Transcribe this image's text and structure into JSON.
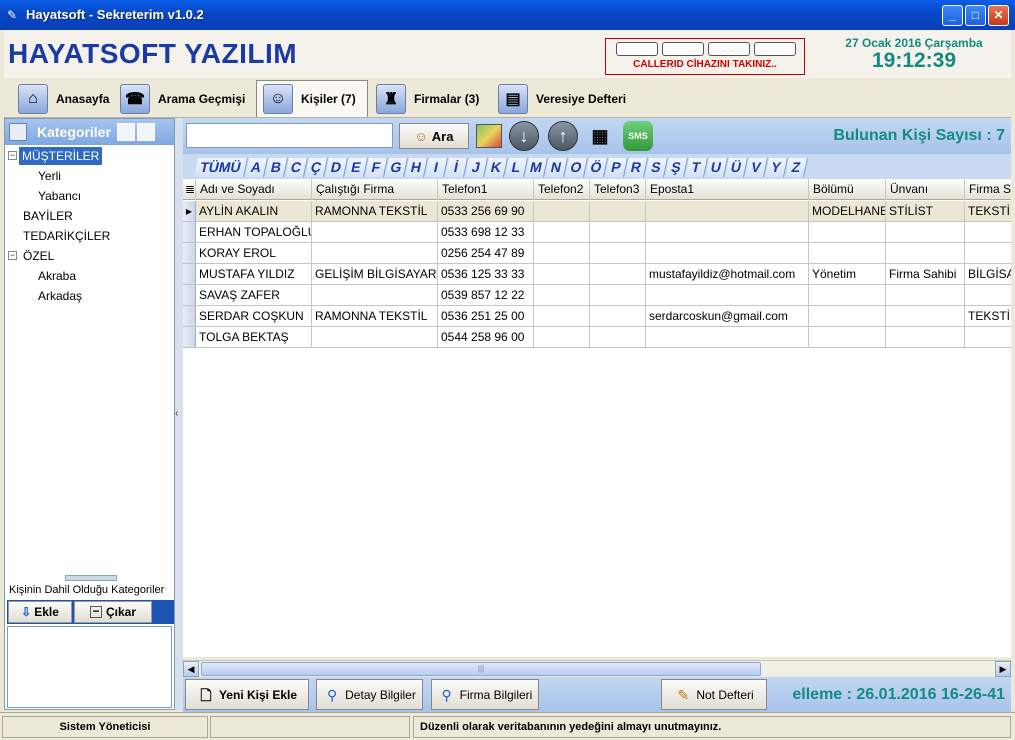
{
  "window": {
    "title": "Hayatsoft - Sekreterim v1.0.2"
  },
  "header": {
    "brand": "HAYATSOFT YAZILIM",
    "callerid_message": "CALLERID CİHAZINI TAKINIZ..",
    "date": "27 Ocak 2016 Çarşamba",
    "time": "19:12:39"
  },
  "tabs": [
    {
      "label": "Anasayfa",
      "icon": "house-icon"
    },
    {
      "label": "Arama Geçmişi",
      "icon": "phone-book-icon"
    },
    {
      "label": "Kişiler (7)",
      "icon": "contacts-icon",
      "active": true
    },
    {
      "label": "Firmalar (3)",
      "icon": "company-icon"
    },
    {
      "label": "Veresiye Defteri",
      "icon": "ledger-icon"
    }
  ],
  "sidebar": {
    "title": "Kategoriler",
    "tree": [
      {
        "label": "MÜŞTERİLER",
        "level": 0,
        "selected": true,
        "expanded": true
      },
      {
        "label": "Yerli",
        "level": 1
      },
      {
        "label": "Yabancı",
        "level": 1
      },
      {
        "label": "BAYİLER",
        "level": 0
      },
      {
        "label": "TEDARİKÇİLER",
        "level": 0
      },
      {
        "label": "ÖZEL",
        "level": 0,
        "expanded": true
      },
      {
        "label": "Akraba",
        "level": 1
      },
      {
        "label": "Arkadaş",
        "level": 1
      }
    ],
    "category_label": "Kişinin Dahil Olduğu Kategoriler",
    "add_label": "Ekle",
    "remove_label": "Çıkar"
  },
  "toolbar": {
    "search_value": "",
    "search_button": "Ara",
    "sms_label": "SMS",
    "found_text": "Bulunan Kişi Sayısı : 7"
  },
  "letters": [
    "TÜMÜ",
    "A",
    "B",
    "C",
    "Ç",
    "D",
    "E",
    "F",
    "G",
    "H",
    "I",
    "İ",
    "J",
    "K",
    "L",
    "M",
    "N",
    "O",
    "Ö",
    "P",
    "R",
    "S",
    "Ş",
    "T",
    "U",
    "Ü",
    "V",
    "Y",
    "Z"
  ],
  "grid": {
    "columns": [
      "Adı ve Soyadı",
      "Çalıştığı Firma",
      "Telefon1",
      "Telefon2",
      "Telefon3",
      "Eposta1",
      "Bölümü",
      "Ünvanı",
      "Firma S"
    ],
    "rows": [
      [
        "AYLİN AKALIN",
        "RAMONNA TEKSTİL",
        "0533 256 69 90",
        "",
        "",
        "",
        "MODELHANE",
        "STİLİST",
        "TEKSTİL"
      ],
      [
        "ERHAN TOPALOĞLU",
        "",
        "0533 698 12 33",
        "",
        "",
        "",
        "",
        "",
        ""
      ],
      [
        "KORAY EROL",
        "",
        "0256 254 47 89",
        "",
        "",
        "",
        "",
        "",
        ""
      ],
      [
        "MUSTAFA YILDIZ",
        "GELİŞİM BİLGİSAYAR",
        "0536 125 33 33",
        "",
        "",
        "mustafayildiz@hotmail.com",
        "Yönetim",
        "Firma Sahibi",
        "BİLGİSA"
      ],
      [
        "SAVAŞ ZAFER",
        "",
        "0539 857 12 22",
        "",
        "",
        "",
        "",
        "",
        ""
      ],
      [
        "SERDAR COŞKUN",
        "RAMONNA TEKSTİL",
        "0536 251 25 00",
        "",
        "",
        "serdarcoskun@gmail.com",
        "",
        "",
        "TEKSTİL"
      ],
      [
        "TOLGA BEKTAŞ",
        "",
        "0544 258 96 00",
        "",
        "",
        "",
        "",
        "",
        ""
      ]
    ]
  },
  "bottom": {
    "new_contact": "Yeni Kişi Ekle",
    "details": "Detay Bilgiler",
    "company_info": "Firma Bilgileri",
    "notes": "Not Defteri",
    "last_update": "elleme : 26.01.2016 16-26-41"
  },
  "status": {
    "user": "Sistem Yöneticisi",
    "middle": "",
    "message": "Düzenli olarak veritabanının yedeğini almayı unutmayınız."
  }
}
